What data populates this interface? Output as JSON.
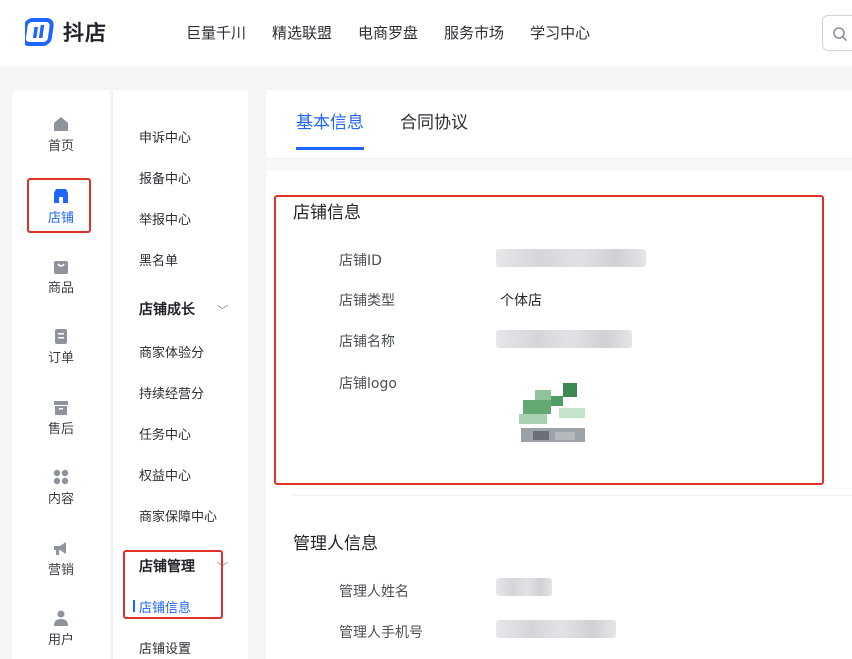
{
  "app": {
    "name": "抖店"
  },
  "topnav": [
    "巨量千川",
    "精选联盟",
    "电商罗盘",
    "服务市场",
    "学习中心"
  ],
  "rail": [
    {
      "label": "首页",
      "icon": "home-icon",
      "active": false
    },
    {
      "label": "店铺",
      "icon": "shop-icon",
      "active": true
    },
    {
      "label": "商品",
      "icon": "product-bag-icon",
      "active": false
    },
    {
      "label": "订单",
      "icon": "order-clipboard-icon",
      "active": false
    },
    {
      "label": "售后",
      "icon": "after-sales-box-icon",
      "active": false
    },
    {
      "label": "内容",
      "icon": "content-grid-icon",
      "active": false
    },
    {
      "label": "营销",
      "icon": "megaphone-icon",
      "active": false
    },
    {
      "label": "用户",
      "icon": "user-icon",
      "active": false
    }
  ],
  "submenu": {
    "items_top": [
      "申诉中心",
      "报备中心",
      "举报中心",
      "黑名单"
    ],
    "group_growth": "店铺成长",
    "items_growth": [
      "商家体验分",
      "持续经营分",
      "任务中心",
      "权益中心",
      "商家保障中心"
    ],
    "group_manage": "店铺管理",
    "manage_active": "店铺信息",
    "manage_next": "店铺设置"
  },
  "tabs": [
    {
      "label": "基本信息",
      "active": true
    },
    {
      "label": "合同协议",
      "active": false
    }
  ],
  "store_info": {
    "title": "店铺信息",
    "id_label": "店铺ID",
    "type_label": "店铺类型",
    "type_value": "个体店",
    "name_label": "店铺名称",
    "logo_label": "店铺logo"
  },
  "manager_info": {
    "title": "管理人信息",
    "name_label": "管理人姓名",
    "phone_label": "管理人手机号"
  },
  "colors": {
    "accent": "#1f66ff",
    "highlight_box": "#e0302a"
  }
}
